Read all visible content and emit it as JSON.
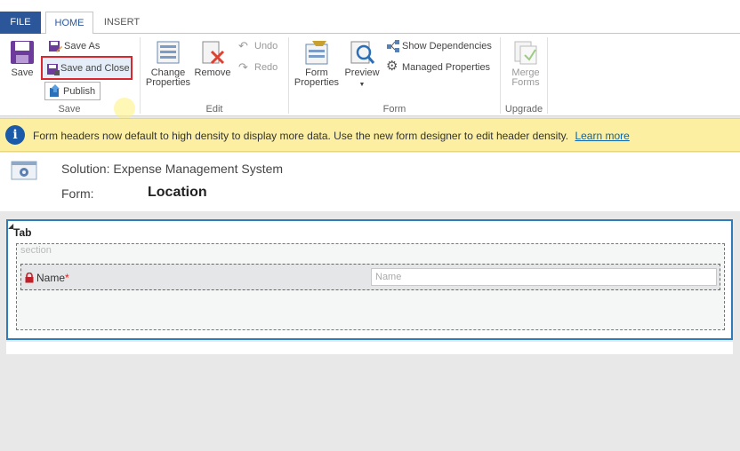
{
  "tabs": {
    "file": "FILE",
    "home": "HOME",
    "insert": "INSERT"
  },
  "ribbon": {
    "save_group": {
      "label": "Save",
      "save": "Save",
      "save_as": "Save As",
      "save_and_close": "Save and Close",
      "publish": "Publish"
    },
    "edit_group": {
      "label": "Edit",
      "change_properties": "Change Properties",
      "remove": "Remove",
      "undo": "Undo",
      "redo": "Redo"
    },
    "form_group": {
      "label": "Form",
      "form_properties": "Form Properties",
      "preview": "Preview",
      "show_dependencies": "Show Dependencies",
      "managed_properties": "Managed Properties"
    },
    "upgrade_group": {
      "label": "Upgrade",
      "merge_forms": "Merge Forms"
    }
  },
  "infobar": {
    "message": "Form headers now default to high density to display more data. Use the new form designer to edit header density.",
    "link": "Learn more"
  },
  "header": {
    "solution": "Solution: Expense Management System",
    "form_label": "Form:",
    "form_name": "Location"
  },
  "form": {
    "tab_title": "Tab",
    "section_title": "section",
    "field_label": "Name",
    "field_required_mark": "*",
    "field_placeholder": "Name"
  },
  "colors": {
    "file_tab": "#2b579a",
    "highlight_border": "#d9272e",
    "info_bar": "#fcefa1",
    "tab_border": "#2e7db8"
  }
}
